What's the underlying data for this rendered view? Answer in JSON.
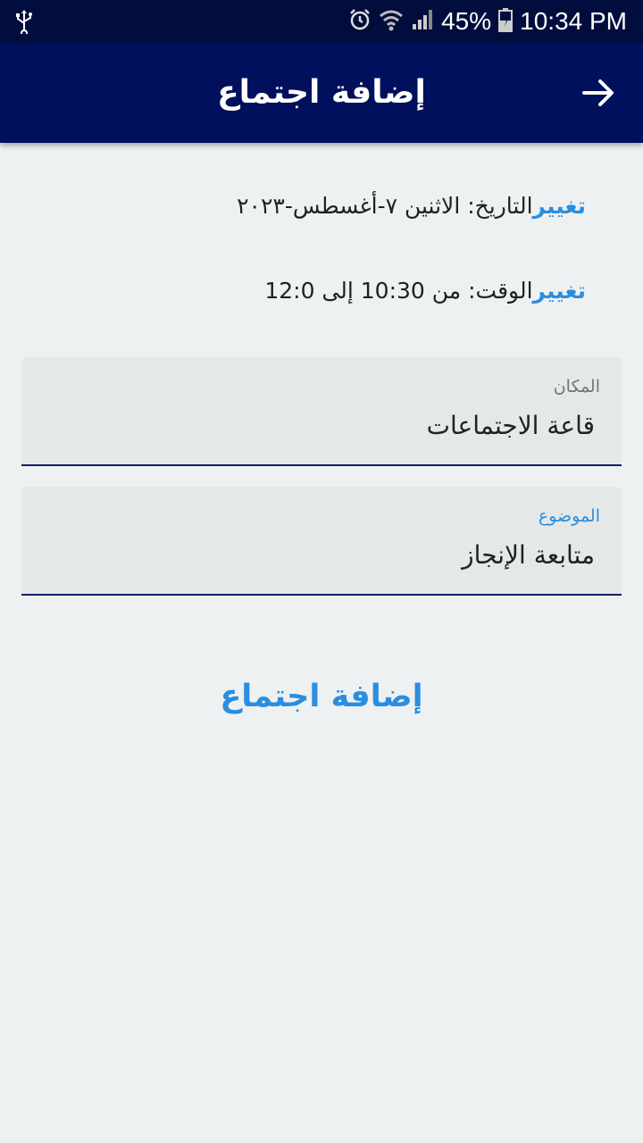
{
  "status_bar": {
    "time": "10:34 PM",
    "battery_percent": "45%"
  },
  "app_bar": {
    "title": "إضافة اجتماع"
  },
  "date_row": {
    "label": "التاريخ: الاثنين ٧-أغسطس-٢٠٢٣",
    "change": "تغيير"
  },
  "time_row": {
    "label": "الوقت: من 10:30 إلى 12:0",
    "change": "تغيير"
  },
  "location_field": {
    "label": "المكان",
    "value": "قاعة الاجتماعات"
  },
  "subject_field": {
    "label": "الموضوع",
    "value": "متابعة الإنجاز"
  },
  "add_button": {
    "label": "إضافة اجتماع"
  },
  "colors": {
    "status_bar": "#000d3d",
    "app_bar": "#00105c",
    "accent": "#2a8ee0",
    "background": "#eef1f1"
  }
}
